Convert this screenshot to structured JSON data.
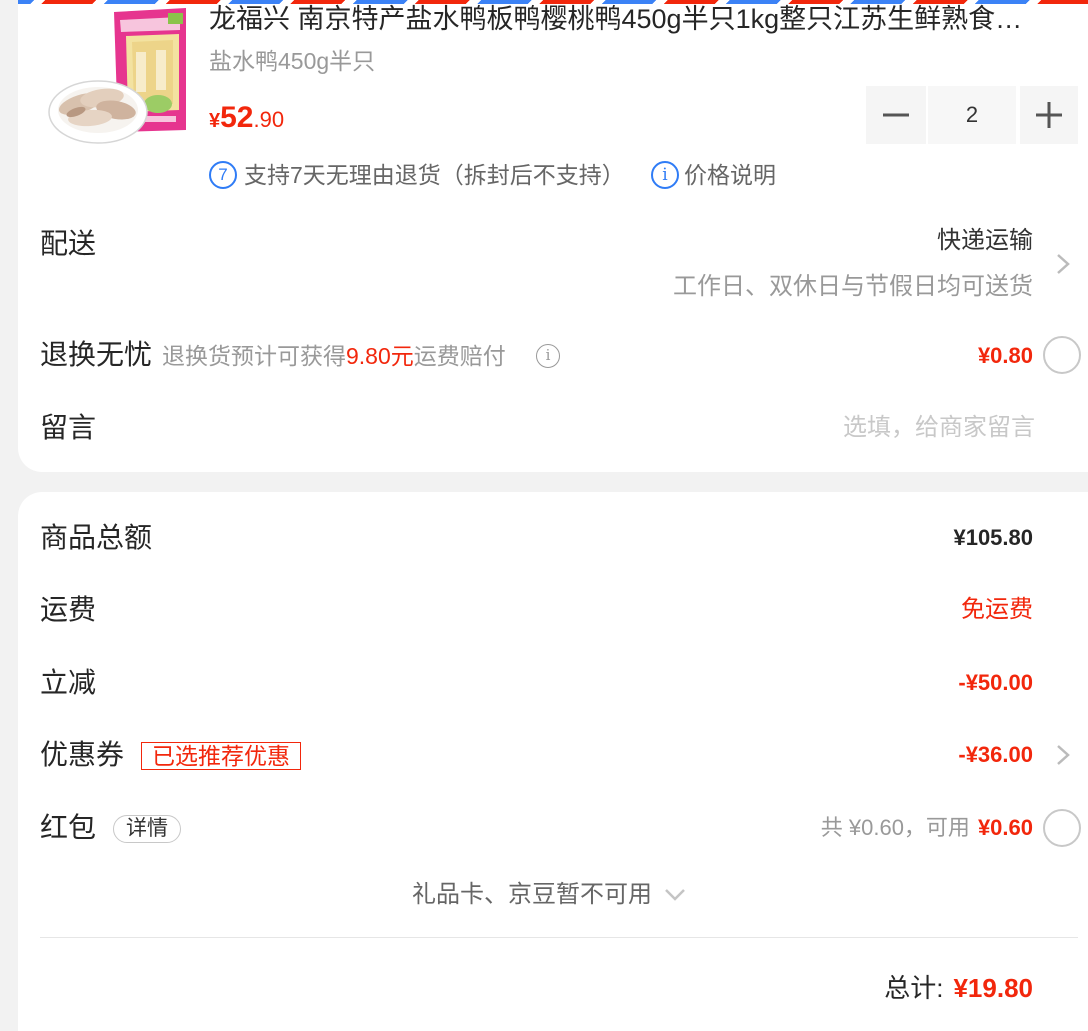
{
  "colors": {
    "accent_red": "#f2270c",
    "info_blue": "#2f7cf6",
    "page_background": "#f2f2f2"
  },
  "product": {
    "image_icon": "product-photo",
    "title": "龙福兴 南京特产盐水鸭板鸭樱桃鸭450g半只1kg整只江苏生鲜熟食…",
    "spec": "盐水鸭450g半只",
    "price_currency": "¥",
    "price_integer": "52",
    "price_decimal": ".90",
    "quantity": "2",
    "decrease_icon": "minus-icon",
    "increase_icon": "plus-icon",
    "return_badge": "7",
    "return_policy": "支持7天无理由退货（拆封后不支持）",
    "info_badge": "i",
    "price_note": "价格说明"
  },
  "delivery": {
    "label": "配送",
    "method": "快递运输",
    "note": "工作日、双休日与节假日均可送货",
    "icon": "chevron-right-icon"
  },
  "return_insurance": {
    "label": "退换无忧",
    "desc_prefix": "退换货预计可获得",
    "desc_amount": "9.80元",
    "desc_suffix": "运费赔付",
    "info_badge": "i",
    "price": "¥0.80",
    "selected": false
  },
  "message": {
    "label": "留言",
    "placeholder": "选填，给商家留言"
  },
  "summary": {
    "goods_total_label": "商品总额",
    "goods_total_value": "¥105.80",
    "shipping_label": "运费",
    "shipping_value": "免运费",
    "discount_label": "立减",
    "discount_value": "-¥50.00",
    "coupon_label": "优惠券",
    "coupon_tag": "已选推荐优惠",
    "coupon_value": "-¥36.00",
    "red_packet_label": "红包",
    "red_packet_detail": "详情",
    "red_packet_total": "共 ¥0.60，可用",
    "red_packet_available": "¥0.60",
    "red_packet_selected": false,
    "unavailable_note": "礼品卡、京豆暂不可用",
    "unavailable_icon": "chevron-down-icon",
    "total_label": "总计:",
    "total_value": "¥19.80"
  }
}
